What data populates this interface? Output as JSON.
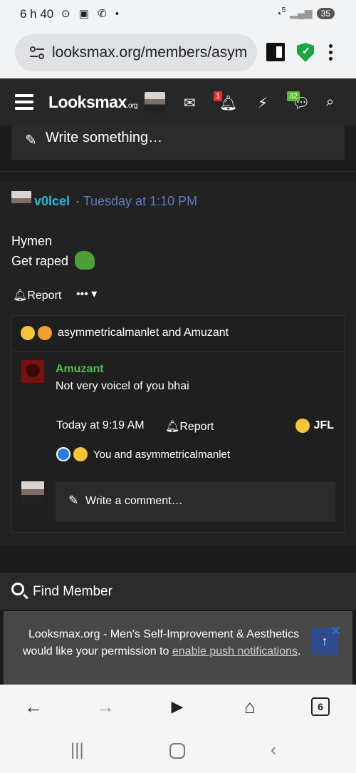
{
  "statusbar": {
    "time": "6 h 40",
    "left_icons": "⊙ ▣ ✆ •",
    "signal": "5",
    "battery": "35"
  },
  "browser": {
    "url": "looksmax.org/members/asym"
  },
  "header": {
    "logo": "Looksmax",
    "logo_suffix": ".org",
    "alerts_badge": "1",
    "conversations_badge": "32"
  },
  "write_status": {
    "label": "Write something…"
  },
  "post": {
    "author": "v0lcel",
    "separator": "·",
    "time": "Tuesday at 1:10 PM",
    "line1": "Hymen",
    "line2": "Get raped",
    "report_label": "Report",
    "more_label": "•••"
  },
  "reactions": {
    "text": "asymmetricalmanlet and Amuzant"
  },
  "comment": {
    "author": "Amuzant",
    "text": "Not very voicel of you bhai",
    "time": "Today at 9:19 AM",
    "report_label": "Report",
    "reaction_label": "JFL",
    "reactions_text": "You and asymmetricalmanlet"
  },
  "comment_input": {
    "placeholder": "Write a comment…"
  },
  "find_member": {
    "label": "Find Member"
  },
  "notice": {
    "line1": "Looksmax.org - Men's Self-Improvement & Aesthetics",
    "line2_prefix": "would like your permission to ",
    "line2_link": "enable push notifications",
    "line2_suffix": "."
  },
  "bottom_nav": {
    "tabs_count": "6"
  }
}
